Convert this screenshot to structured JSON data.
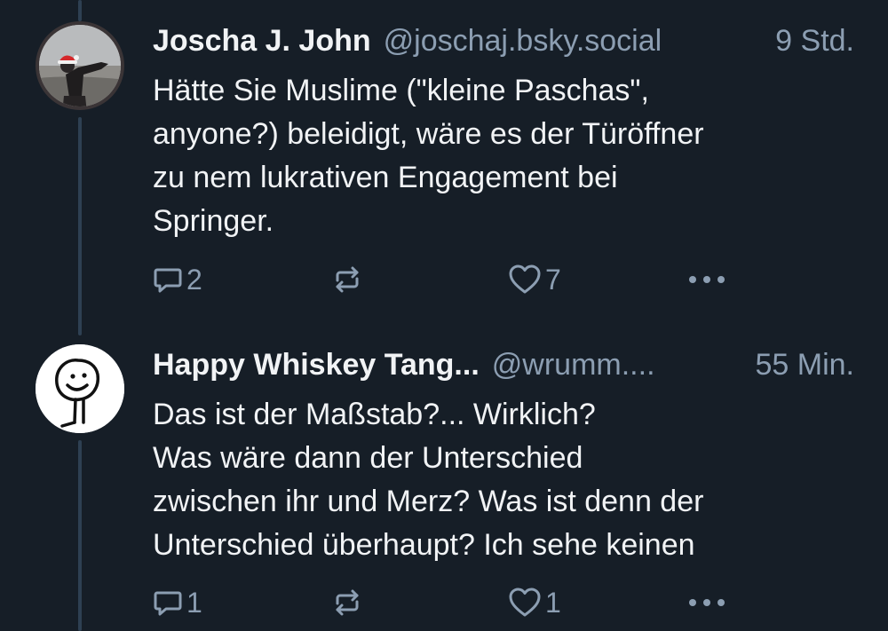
{
  "posts": [
    {
      "author_name": "Joscha J. John",
      "handle": "@joschaj.bsky.social",
      "time": "9 Std.",
      "text_lines": [
        "Hätte Sie Muslime (\"kleine Paschas\",",
        "anyone?) beleidigt, wäre es der Türöffner",
        "zu nem lukrativen Engagement bei",
        "Springer."
      ],
      "reply_count": "2",
      "like_count": "7",
      "avatar_icon": "photo-avatar-santa-hat"
    },
    {
      "author_name": "Happy Whiskey Tang...",
      "handle": "@wrumm....",
      "time": "55 Min.",
      "text_lines": [
        "Das ist der Maßstab?... Wirklich?",
        "Was wäre dann der Unterschied",
        "zwischen ihr und Merz? Was ist denn der",
        "Unterschied überhaupt? Ich sehe keinen"
      ],
      "reply_count": "1",
      "like_count": "1",
      "avatar_icon": "smiley-stick-figure-avatar"
    }
  ],
  "colors": {
    "background": "#161e27",
    "text": "#f1f3f5",
    "muted": "#8c9eb2",
    "thread_line": "#2e4052"
  }
}
